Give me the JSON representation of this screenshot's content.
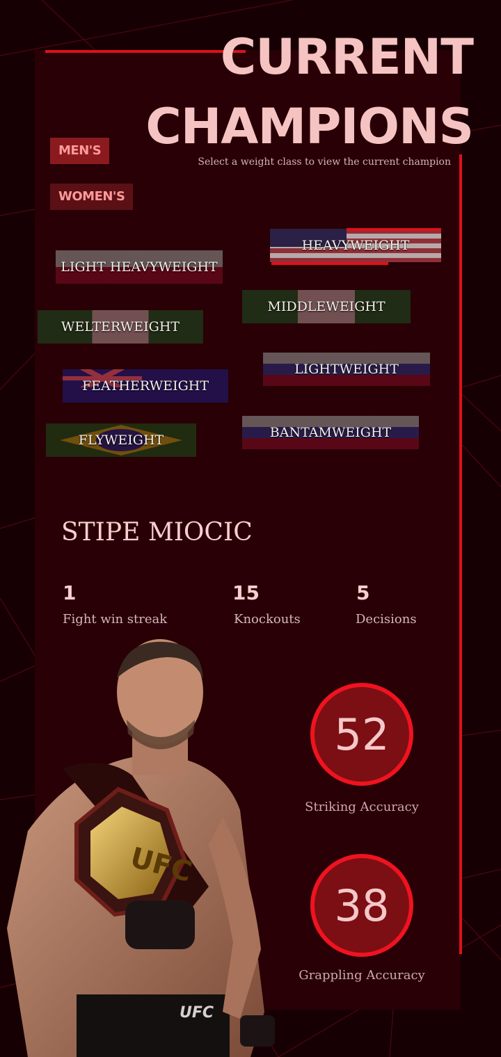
{
  "header": {
    "title_line1": "CURRENT",
    "title_line2": "CHAMPIONS",
    "subtitle": "Select a weight class to view the current champion"
  },
  "tabs": {
    "mens": "MEN'S",
    "womens": "WOMEN'S"
  },
  "weight_classes": [
    {
      "label": "HEAVYWEIGHT",
      "flag": "usa-flag"
    },
    {
      "label": "LIGHT HEAVYWEIGHT",
      "flag": "poland-flag"
    },
    {
      "label": "MIDDLEWEIGHT",
      "flag": "nigeria-flag"
    },
    {
      "label": "WELTERWEIGHT",
      "flag": "nigeria-flag"
    },
    {
      "label": "LIGHTWEIGHT",
      "flag": "russia-flag"
    },
    {
      "label": "FEATHERWEIGHT",
      "flag": "australia-flag"
    },
    {
      "label": "BANTAMWEIGHT",
      "flag": "russia-flag"
    },
    {
      "label": "FLYWEIGHT",
      "flag": "brazil-flag"
    }
  ],
  "champion": {
    "name": "STIPE MIOCIC",
    "stats": [
      {
        "value": "1",
        "label": "Fight win streak"
      },
      {
        "value": "15",
        "label": "Knockouts"
      },
      {
        "value": "5",
        "label": "Decisions"
      }
    ],
    "accuracy": [
      {
        "value": "52",
        "label": "Striking Accuracy"
      },
      {
        "value": "38",
        "label": "Grappling Accuracy"
      }
    ]
  },
  "colors": {
    "accent": "#e0101a",
    "background": "#170003",
    "panel": "#2a0006",
    "text": "#f6c3c3"
  }
}
